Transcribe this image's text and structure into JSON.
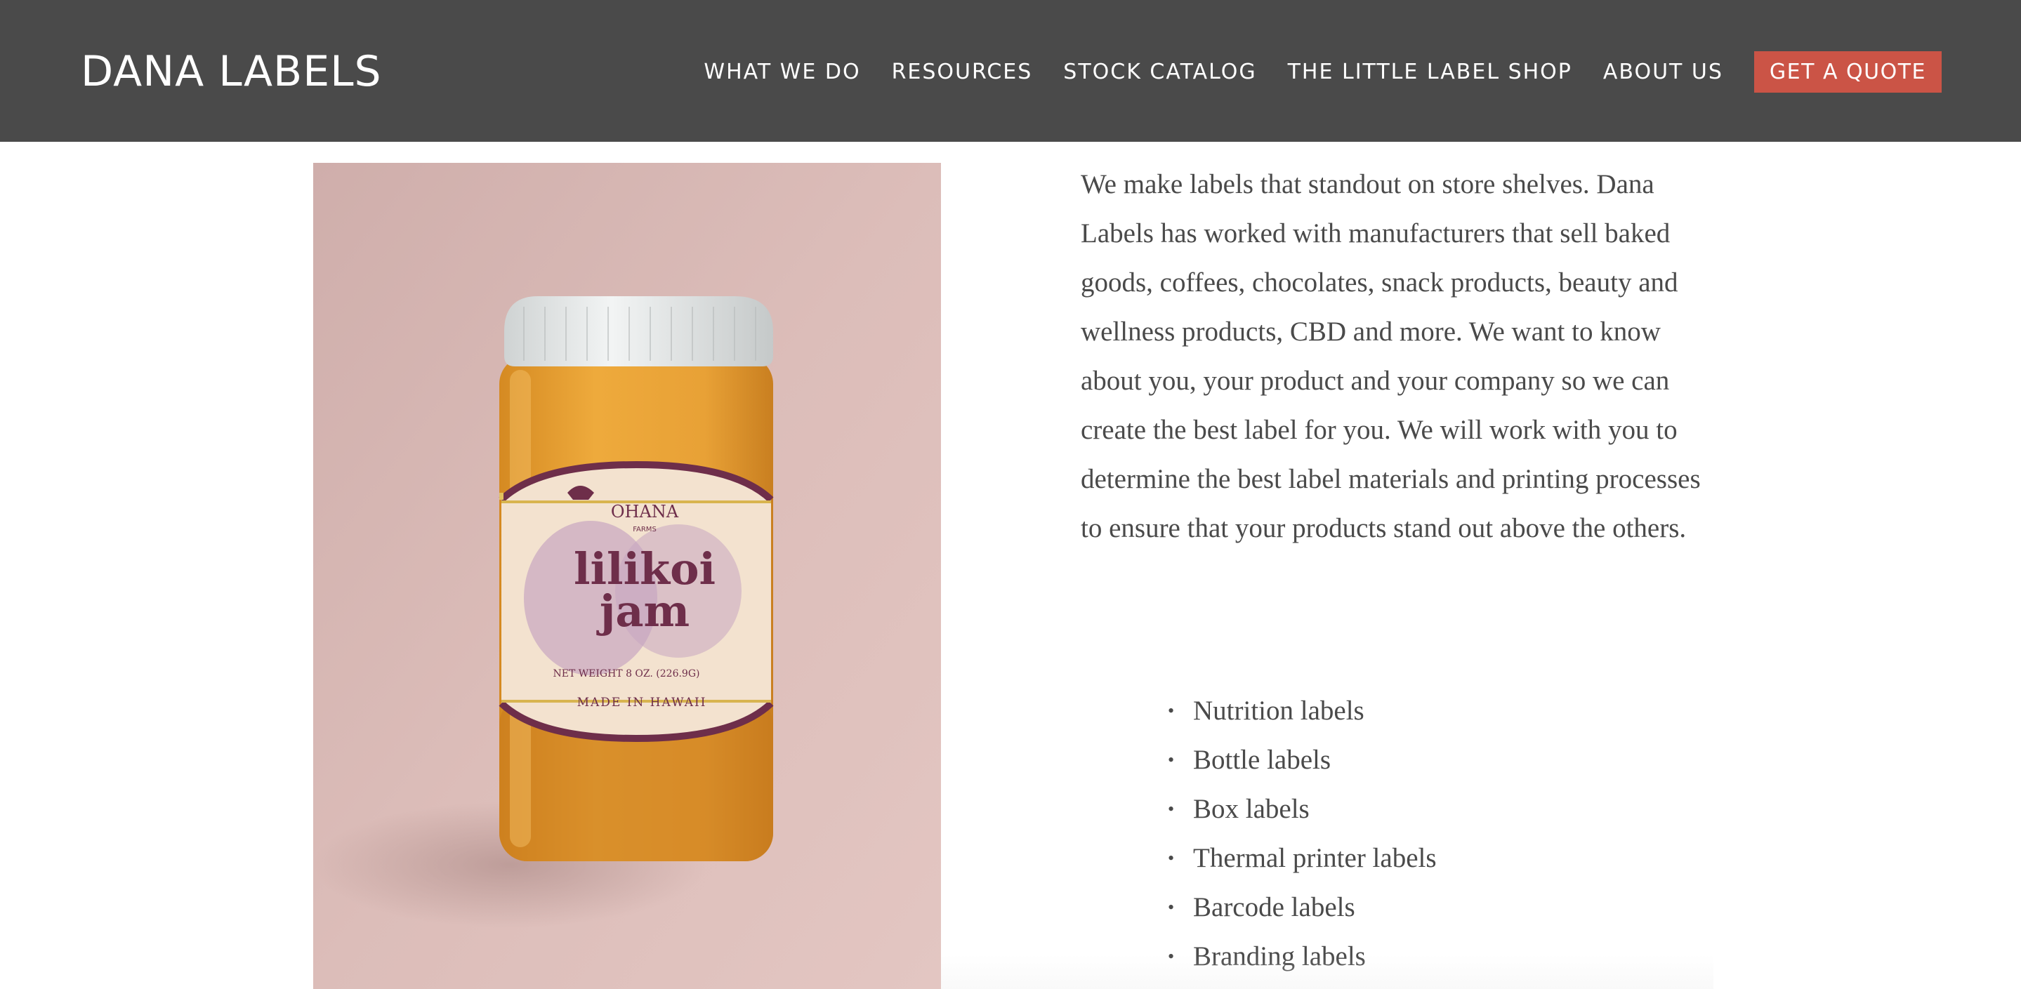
{
  "header": {
    "logo": "DANA LABELS",
    "nav": [
      {
        "label": "WHAT WE DO"
      },
      {
        "label": "RESOURCES"
      },
      {
        "label": "STOCK CATALOG"
      },
      {
        "label": "THE LITTLE LABEL SHOP"
      },
      {
        "label": "ABOUT US"
      }
    ],
    "cta": "GET A QUOTE"
  },
  "product_image": {
    "brand": "OHANA",
    "brand_sub": "FARMS",
    "name_line1": "lilikoi",
    "name_line2": "jam",
    "weight": "NET WEIGHT 8 OZ. (226.9G)",
    "origin": "MADE IN HAWAII"
  },
  "main": {
    "intro": "We make labels that standout on store shelves. Dana Labels has worked with manufacturers that sell baked goods, coffees, chocolates, snack products, beauty and wellness products, CBD and more. We want to know about you, your product and your company so we can create the best label for you. We will work with you to determine the best label materials and printing processes to ensure that your products stand out above the others.",
    "features": [
      "Nutrition labels",
      "Bottle labels",
      "Box labels",
      "Thermal printer labels",
      "Barcode labels",
      "Branding labels"
    ]
  },
  "colors": {
    "header_bg": "#4a4a4a",
    "cta_bg": "#cb5446",
    "text": "#4a4a4a",
    "photo_bg": "#dcbdb9",
    "jam": "#e9a134",
    "label_accent": "#6e2e4a"
  }
}
